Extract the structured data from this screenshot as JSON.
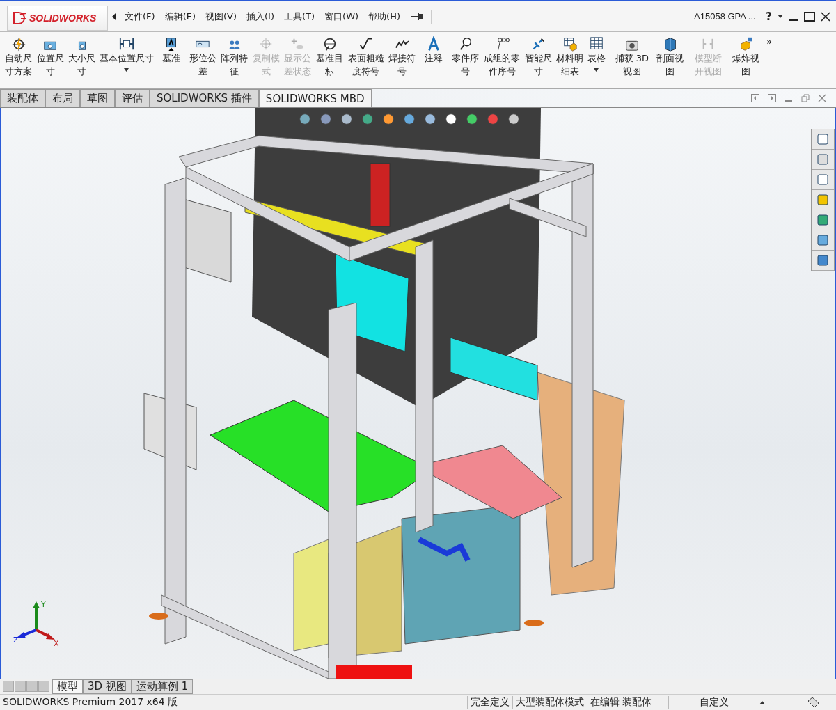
{
  "app": {
    "logo": "SOLIDWORKS"
  },
  "menu": [
    {
      "label": "文件(F)"
    },
    {
      "label": "编辑(E)"
    },
    {
      "label": "视图(V)"
    },
    {
      "label": "插入(I)"
    },
    {
      "label": "工具(T)"
    },
    {
      "label": "窗口(W)"
    },
    {
      "label": "帮助(H)"
    }
  ],
  "window": {
    "title": "A15058 GPA ...",
    "help": "?"
  },
  "ribbon": [
    {
      "label": "自动尺寸方案",
      "disabled": false,
      "dropdown": false
    },
    {
      "label": "位置尺寸",
      "disabled": false,
      "dropdown": false
    },
    {
      "label": "大小尺寸",
      "disabled": false,
      "dropdown": false
    },
    {
      "label": "基本位置尺寸",
      "disabled": false,
      "dropdown": true
    },
    {
      "label": "基准",
      "disabled": false,
      "dropdown": false
    },
    {
      "label": "形位公差",
      "disabled": false,
      "dropdown": false
    },
    {
      "label": "阵列特征",
      "disabled": false,
      "dropdown": false
    },
    {
      "label": "复制模式",
      "disabled": true,
      "dropdown": false
    },
    {
      "label": "显示公差状态",
      "disabled": true,
      "dropdown": false
    },
    {
      "label": "基准目标",
      "disabled": false,
      "dropdown": false
    },
    {
      "label": "表面粗糙度符号",
      "disabled": false,
      "dropdown": false
    },
    {
      "label": "焊接符号",
      "disabled": false,
      "dropdown": false
    },
    {
      "label": "注释",
      "disabled": false,
      "dropdown": false
    },
    {
      "label": "零件序号",
      "disabled": false,
      "dropdown": false
    },
    {
      "label": "成组的零件序号",
      "disabled": false,
      "dropdown": false
    },
    {
      "label": "智能尺寸",
      "disabled": false,
      "dropdown": false
    },
    {
      "label": "材料明细表",
      "disabled": false,
      "dropdown": false
    },
    {
      "label": "表格",
      "disabled": false,
      "dropdown": true
    }
  ],
  "ribbon_views": [
    {
      "label": "捕获 3D视图",
      "disabled": false
    },
    {
      "label": "剖面视图",
      "disabled": false
    },
    {
      "label": "模型断开视图",
      "disabled": true
    },
    {
      "label": "爆炸视图",
      "disabled": false
    }
  ],
  "ribbon_overflow": "»",
  "tabs": [
    {
      "label": "装配体",
      "selected": false
    },
    {
      "label": "布局",
      "selected": false
    },
    {
      "label": "草图",
      "selected": false
    },
    {
      "label": "评估",
      "selected": false
    },
    {
      "label": "SOLIDWORKS 插件",
      "selected": false
    },
    {
      "label": "SOLIDWORKS MBD",
      "selected": true
    }
  ],
  "triad": {
    "x": "X",
    "y": "Y",
    "z": "Z"
  },
  "bottom_tabs": [
    {
      "label": "模型",
      "selected": true
    },
    {
      "label": "3D 视图",
      "selected": false
    },
    {
      "label": "运动算例 1",
      "selected": false
    }
  ],
  "status_bar": {
    "product": "SOLIDWORKS Premium 2017 x64 版",
    "items": [
      "完全定义",
      "大型装配体模式",
      "在编辑 装配体"
    ],
    "units": "自定义"
  }
}
